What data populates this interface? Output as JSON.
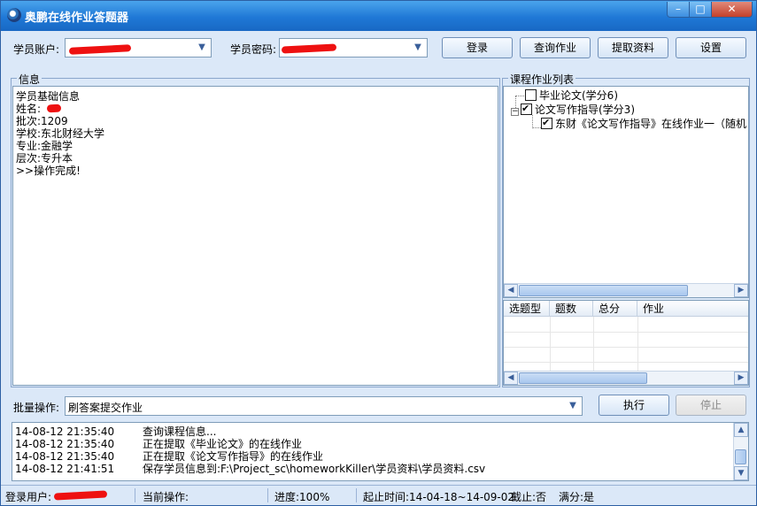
{
  "window": {
    "title": "奥鹏在线作业答题器",
    "controls": {
      "minimize": "–",
      "maximize": "□",
      "close": "✕"
    }
  },
  "toolbar": {
    "account_label": "学员账户:",
    "account_value": "",
    "password_label": "学员密码:",
    "password_value": "",
    "login_label": "登录",
    "query_label": "查询作业",
    "fetch_label": "提取资料",
    "settings_label": "设置"
  },
  "info_panel": {
    "caption": "信息",
    "lines": [
      "学员基础信息",
      "姓名:",
      "批次:1209",
      "学校:东北财经大学",
      "专业:金融学",
      "层次:专升本",
      ">>操作完成!"
    ]
  },
  "course_panel": {
    "caption": "课程作业列表",
    "tree": [
      {
        "label": "毕业论文(学分6)",
        "checked": false
      },
      {
        "label": "论文写作指导(学分3)",
        "checked": true,
        "expander": "−"
      },
      {
        "label": "东财《论文写作指导》在线作业一（随机",
        "checked": true
      }
    ],
    "columns": [
      "选题型",
      "题数",
      "总分",
      "作业"
    ]
  },
  "batch": {
    "label": "批量操作:",
    "selected": "刷答案提交作业",
    "execute_label": "执行",
    "stop_label": "停止"
  },
  "log": [
    {
      "time": "14-08-12 21:35:40",
      "msg": "查询课程信息..."
    },
    {
      "time": "14-08-12 21:35:40",
      "msg": "正在提取《毕业论文》的在线作业"
    },
    {
      "time": "14-08-12 21:35:40",
      "msg": "正在提取《论文写作指导》的在线作业"
    },
    {
      "time": "14-08-12 21:41:51",
      "msg": "保存学员信息到:F:\\Project_sc\\homeworkKiller\\学员资料\\学员资料.csv"
    }
  ],
  "status": {
    "user_label": "登录用户:",
    "current_op": "当前操作:",
    "progress": "进度:100%",
    "period": "起止时间:14-04-18~14-09-02",
    "deadline": "截止:否",
    "full_score": "满分:是"
  },
  "colors": {
    "title_bar": "#1f78d6",
    "panel_bg": "#dbe8f8",
    "redaction": "#ee1111"
  }
}
